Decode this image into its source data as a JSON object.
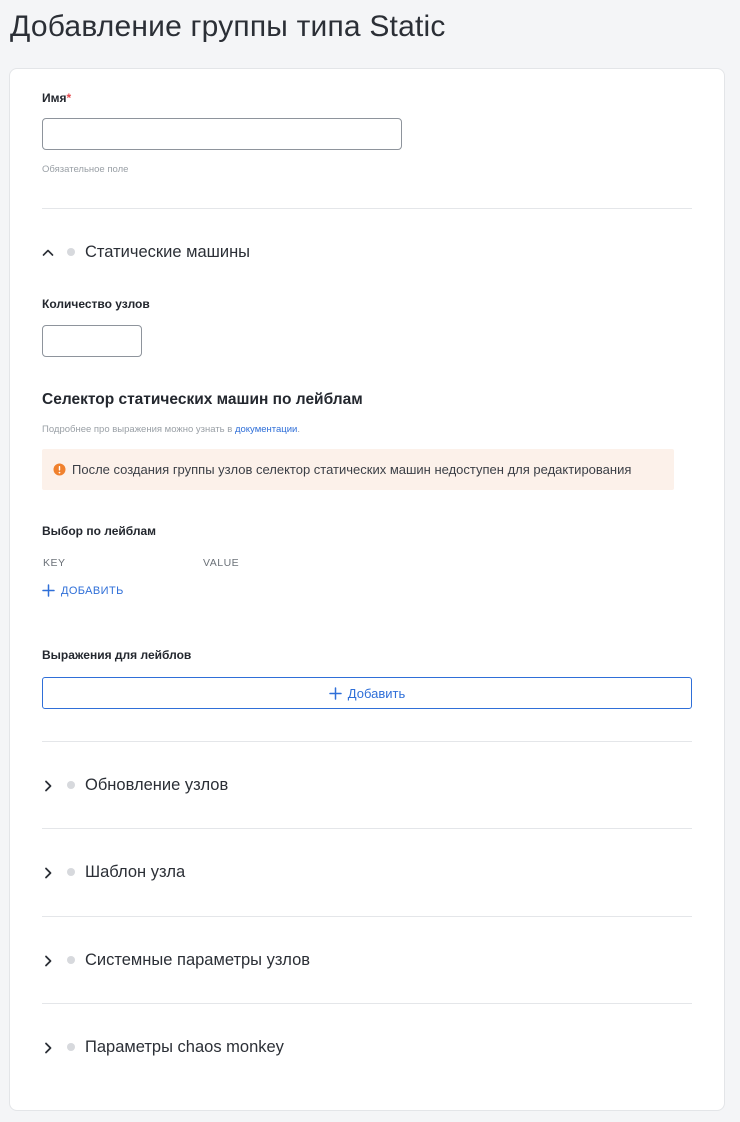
{
  "page": {
    "title": "Добавление группы типа Static"
  },
  "form": {
    "name": {
      "label": "Имя",
      "required_mark": "*",
      "value": "",
      "placeholder": "",
      "hint": "Обязательное поле"
    }
  },
  "sections": {
    "static_machines": {
      "title": "Статические машины",
      "expanded": true,
      "node_count": {
        "label": "Количество узлов",
        "value": ""
      },
      "selector": {
        "title": "Селектор статических машин по лейблам",
        "help_prefix": "Подробнее про выражения можно узнать в ",
        "help_link": "документации",
        "help_suffix": ".",
        "alert": "После создания группы узлов селектор статических машин недоступен для редактирования",
        "alert_color": "#f0812e",
        "match_labels": {
          "title": "Выбор по лейблам",
          "key_header": "KEY",
          "value_header": "VALUE",
          "add_label": "ДОБАВИТЬ"
        },
        "expressions": {
          "title": "Выражения для лейблов",
          "add_label": "Добавить"
        }
      }
    },
    "node_update": {
      "title": "Обновление узлов",
      "expanded": false
    },
    "node_template": {
      "title": "Шаблон узла",
      "expanded": false
    },
    "system_params": {
      "title": "Системные параметры узлов",
      "expanded": false
    },
    "chaos_monkey": {
      "title": "Параметры chaos monkey",
      "expanded": false
    }
  },
  "icons": {
    "expanded": "chevron-up-icon",
    "collapsed": "chevron-right-icon",
    "status": "status-dot-icon",
    "warning": "warning-circle-icon",
    "add": "plus-icon"
  },
  "colors": {
    "accent": "#2f6fd8",
    "required": "#e5484d",
    "alert_bg": "#fcf1ea"
  }
}
